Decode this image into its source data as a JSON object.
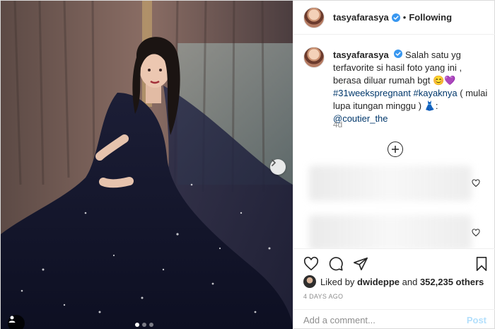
{
  "header": {
    "username": "tasyafarasya",
    "separator": "•",
    "follow_state": "Following",
    "verified_icon": "verified-badge-icon"
  },
  "caption": {
    "username": "tasyafarasya",
    "text_1": "Salah satu yg terfavorite si hasil foto yang ini , berasa diluar rumah bgt",
    "emoji_1": "😊",
    "emoji_2": "💜",
    "hashtag_1": "#31weekspregnant",
    "hashtag_2": "#kayaknya",
    "text_2": "( mulai lupa itungan minggu )",
    "emoji_3": "👗",
    "text_3": ":",
    "mention": "@coutier_the",
    "time_ago": "4d"
  },
  "actions": {
    "icons": [
      "heart-icon",
      "comment-icon",
      "share-icon",
      "bookmark-icon"
    ]
  },
  "likes": {
    "prefix": "Liked by",
    "user": "dwideppe",
    "joiner": "and",
    "count": "352,235 others"
  },
  "date": "4 DAYS AGO",
  "comment_box": {
    "placeholder": "Add a comment...",
    "post_label": "Post"
  },
  "colors": {
    "link": "#00376b",
    "muted": "#8e8e8e",
    "post_disabled": "#b2dffc",
    "verified": "#3897f0"
  }
}
